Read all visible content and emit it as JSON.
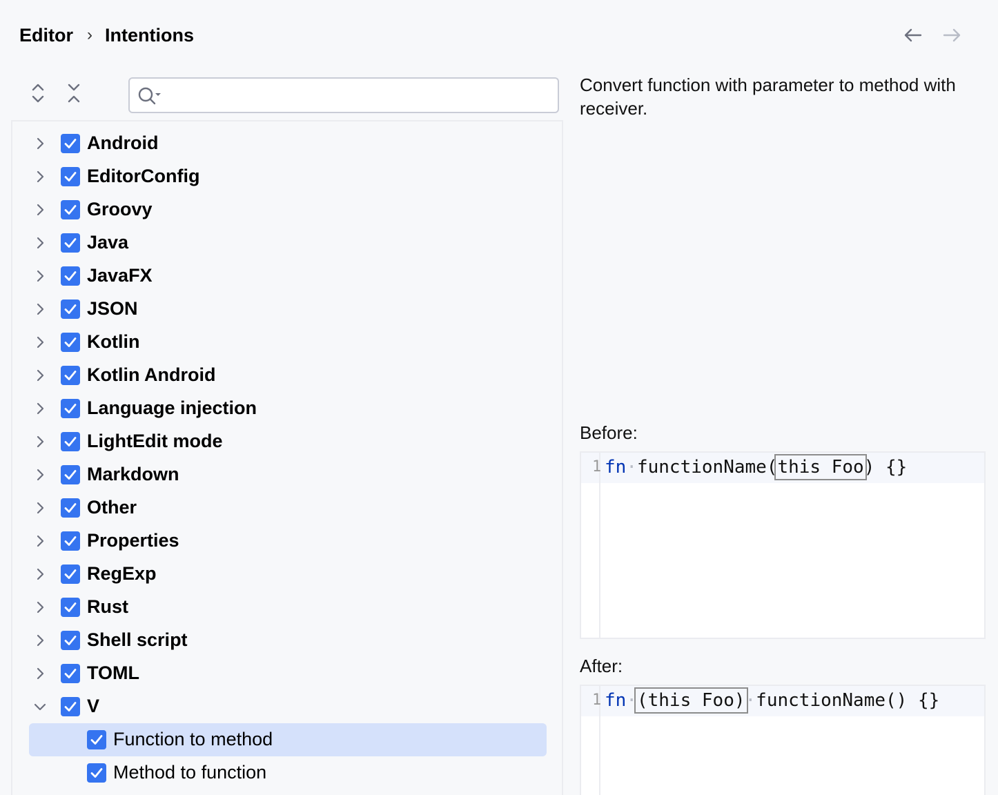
{
  "breadcrumb": {
    "parent": "Editor",
    "separator": "›",
    "current": "Intentions"
  },
  "search": {
    "value": "",
    "placeholder": ""
  },
  "tree": {
    "items": [
      {
        "label": "Android",
        "checked": true,
        "expanded": false
      },
      {
        "label": "EditorConfig",
        "checked": true,
        "expanded": false
      },
      {
        "label": "Groovy",
        "checked": true,
        "expanded": false
      },
      {
        "label": "Java",
        "checked": true,
        "expanded": false
      },
      {
        "label": "JavaFX",
        "checked": true,
        "expanded": false
      },
      {
        "label": "JSON",
        "checked": true,
        "expanded": false
      },
      {
        "label": "Kotlin",
        "checked": true,
        "expanded": false
      },
      {
        "label": "Kotlin Android",
        "checked": true,
        "expanded": false
      },
      {
        "label": "Language injection",
        "checked": true,
        "expanded": false
      },
      {
        "label": "LightEdit mode",
        "checked": true,
        "expanded": false
      },
      {
        "label": "Markdown",
        "checked": true,
        "expanded": false
      },
      {
        "label": "Other",
        "checked": true,
        "expanded": false
      },
      {
        "label": "Properties",
        "checked": true,
        "expanded": false
      },
      {
        "label": "RegExp",
        "checked": true,
        "expanded": false
      },
      {
        "label": "Rust",
        "checked": true,
        "expanded": false
      },
      {
        "label": "Shell script",
        "checked": true,
        "expanded": false
      },
      {
        "label": "TOML",
        "checked": true,
        "expanded": false
      },
      {
        "label": "V",
        "checked": true,
        "expanded": true
      }
    ],
    "children": [
      {
        "label": "Function to method",
        "checked": true,
        "selected": true
      },
      {
        "label": "Method to function",
        "checked": true,
        "selected": false
      }
    ]
  },
  "description": "Convert function with parameter to method with receiver.",
  "before": {
    "label": "Before:",
    "line_number": "1",
    "keyword": "fn",
    "name": "functionName(",
    "boxed": "this Foo",
    "rest": ") {}"
  },
  "after": {
    "label": "After:",
    "line_number": "1",
    "keyword": "fn",
    "boxed": "(this Foo)",
    "rest": "functionName() {}"
  },
  "colors": {
    "accent": "#3574f0",
    "selection": "#d5e1fb",
    "keyword": "#0033b3"
  }
}
